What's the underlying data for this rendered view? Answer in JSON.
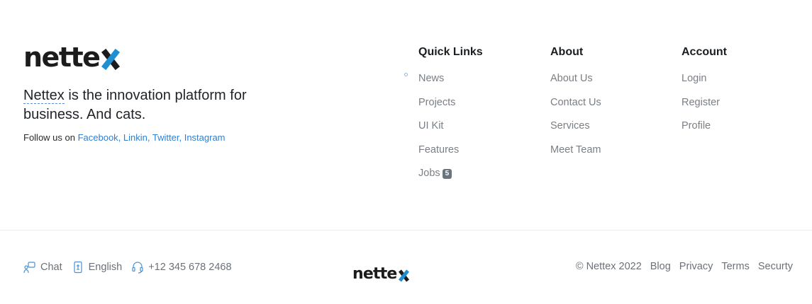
{
  "brand": {
    "logo_text": "nette",
    "tagline_brand": "Nettex",
    "tagline_rest": " is the innovation platform for business. And cats."
  },
  "follow": {
    "prefix": "Follow us on ",
    "links": [
      "Facebook",
      "Linkin",
      "Twitter",
      "Instagram"
    ],
    "separator": ", "
  },
  "columns": {
    "quick_links": {
      "title": "Quick Links",
      "items": [
        "News",
        "Projects",
        "UI Kit",
        "Features",
        "Jobs"
      ],
      "jobs_badge": "5"
    },
    "about": {
      "title": "About",
      "items": [
        "About Us",
        "Contact Us",
        "Services",
        "Meet Team"
      ]
    },
    "account": {
      "title": "Account",
      "items": [
        "Login",
        "Register",
        "Profile"
      ]
    }
  },
  "footer_bottom": {
    "chat": "Chat",
    "language": "English",
    "phone": "+12 345 678 2468",
    "copyright": "© Nettex 2022",
    "links": [
      "Blog",
      "Privacy",
      "Terms",
      "Securty"
    ]
  },
  "colors": {
    "accent": "#1f8fd1",
    "link": "#2f7fd1",
    "muted": "#7a7f85",
    "badge": "#6c757d"
  }
}
